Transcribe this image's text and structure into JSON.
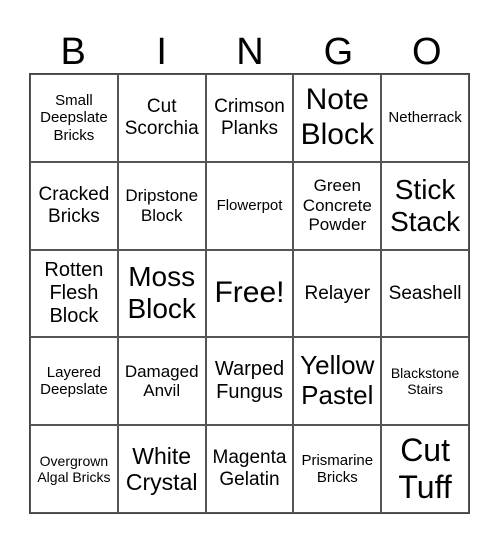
{
  "header": [
    "B",
    "I",
    "N",
    "G",
    "O"
  ],
  "cells": [
    "Small Deepslate Bricks",
    "Cut Scorchia",
    "Crimson Planks",
    "Note Block",
    "Netherrack",
    "Cracked Bricks",
    "Dripstone Block",
    "Flowerpot",
    "Green Concrete Powder",
    "Stick Stack",
    "Rotten Flesh Block",
    "Moss Block",
    "Free!",
    "Relayer",
    "Seashell",
    "Layered Deepslate",
    "Damaged Anvil",
    "Warped Fungus",
    "Yellow Pastel",
    "Blackstone Stairs",
    "Overgrown Algal Bricks",
    "White Crystal",
    "Magenta Gelatin",
    "Prismarine Bricks",
    "Cut Tuff"
  ]
}
